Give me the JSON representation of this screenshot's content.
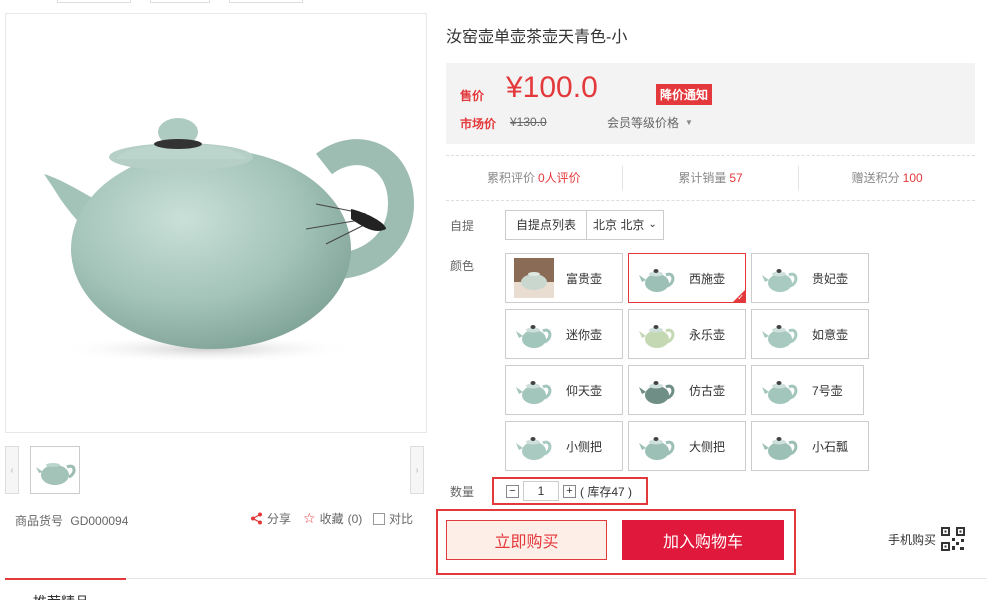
{
  "product": {
    "title": "汝窑壶单壶茶壶天青色-小",
    "sku_label": "商品货号",
    "sku": "GD000094"
  },
  "actions": {
    "share": "分享",
    "favorite": "收藏",
    "favorite_count": "(0)",
    "compare": "对比"
  },
  "price": {
    "sale_label": "售价",
    "sale": "¥100.0",
    "notify": "降价通知",
    "market_label": "市场价",
    "market": "¥130.0",
    "member": "会员等级价格"
  },
  "stats": {
    "reviews_label": "累积评价",
    "reviews": "0人评价",
    "sales_label": "累计销量",
    "sales": "57",
    "points_label": "赠送积分",
    "points": "100"
  },
  "pickup": {
    "label": "自提",
    "list": "自提点列表",
    "city": "北京 北京"
  },
  "color": {
    "label": "颜色",
    "selected_index": 1,
    "options": [
      {
        "name": "富贵壶",
        "icon": "teapot-photo-icon"
      },
      {
        "name": "西施壶",
        "icon": "teapot-icon"
      },
      {
        "name": "贵妃壶",
        "icon": "teapot-icon"
      },
      {
        "name": "迷你壶",
        "icon": "teapot-icon"
      },
      {
        "name": "永乐壶",
        "icon": "teapot-icon"
      },
      {
        "name": "如意壶",
        "icon": "teapot-icon"
      },
      {
        "name": "仰天壶",
        "icon": "teapot-icon"
      },
      {
        "name": "仿古壶",
        "icon": "teapot-icon"
      },
      {
        "name": "7号壶",
        "icon": "teapot-icon"
      },
      {
        "name": "小侧把",
        "icon": "teapot-icon"
      },
      {
        "name": "大侧把",
        "icon": "teapot-icon"
      },
      {
        "name": "小石瓢",
        "icon": "teapot-icon"
      }
    ]
  },
  "quantity": {
    "label": "数量",
    "minus": "−",
    "value": "1",
    "plus": "+",
    "stock": "( 库存47 )"
  },
  "buttons": {
    "buy_now": "立即购买",
    "add_cart": "加入购物车",
    "mobile_buy": "手机购买"
  },
  "tabs": {
    "recommend": "推荐精品"
  },
  "colors": {
    "accent": "#e4393c",
    "cart": "#e0193c",
    "celadon": "#a7c7bd"
  }
}
